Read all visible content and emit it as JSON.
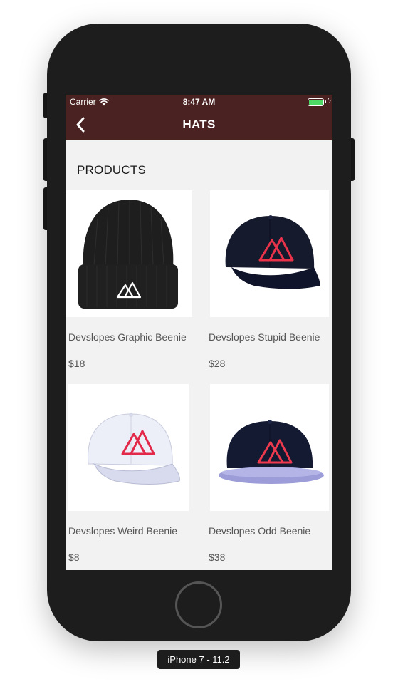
{
  "status_bar": {
    "carrier": "Carrier",
    "time": "8:47 AM",
    "battery_color": "#4cd964"
  },
  "nav": {
    "title": "HATS",
    "back_icon": "chevron-left-icon",
    "bar_color": "#4b2222"
  },
  "section": {
    "title": "PRODUCTS"
  },
  "products": [
    {
      "name": "Devslopes Graphic Beenie",
      "price": "$18"
    },
    {
      "name": "Devslopes Stupid Beenie",
      "price": "$28"
    },
    {
      "name": "Devslopes Weird Beenie",
      "price": "$8"
    },
    {
      "name": "Devslopes Odd Beenie",
      "price": "$38"
    }
  ],
  "simulator": {
    "label": "iPhone 7 - 11.2"
  }
}
